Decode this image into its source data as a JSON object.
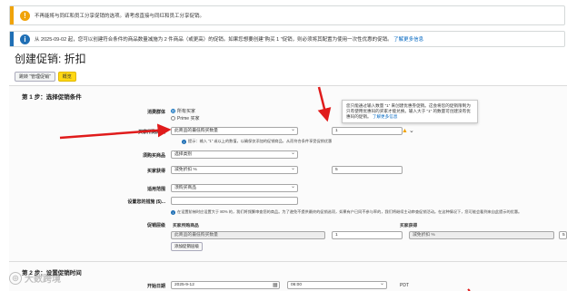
{
  "alerts": {
    "warning": {
      "text": "不再能将与同红和员工分享促销的选项。请考虑直接与同红和员工分享促销。"
    },
    "info": {
      "text": "从 2025-09-02 起，您可以创建符合条件的商品数量减施为 2 件商品（或更高）的促销。如果您想要创建“购买 1 ”促销，则必须将其配置为使用一次性优惠的促销。",
      "link": "了解更多信息"
    }
  },
  "page": {
    "title": "创建促销: 折扣",
    "badges": [
      "跳转 “管理促销”",
      "概览"
    ]
  },
  "step1": {
    "title": "第 1 步：选择促销条件",
    "buyer": {
      "label": "消费群体",
      "options": [
        "所有买家",
        "Prime 买家"
      ],
      "selected": 0
    },
    "condition": {
      "label": "买家所购商品",
      "select_value": "此商品的最低购买数量",
      "qty": "1",
      "hint": "提示：输入 “1” 或以上的数值，以确保仅添加的促销商品，从而符合条件享受促销优惠"
    },
    "purchased_items": {
      "label": "须购买商品",
      "select_value": "选择类别"
    },
    "buyer_gets": {
      "label": "买家获得",
      "select_value": "减免折扣 %",
      "value": "5"
    },
    "applies_to": {
      "label": "适用范围",
      "select_value": "须购买商品"
    },
    "tiers": {
      "label": "设置您的措施 ($)...",
      "hint": "在设置阶梯时应设置大于 80% 的，我们将频繁审查您的商品。为了避免不提供最终的促销选项，如果有户已同不参与率的，我们将继续主动审查促销活动。在这种情况下，您可能会看到来自此提示的优惠。"
    },
    "tiers_table": {
      "label": "促销层级",
      "headers": [
        "买家所购商品",
        "买家获得"
      ],
      "row": {
        "condition": "此商品的最低购买数量",
        "qty": "1",
        "benefit": "减免折扣 %",
        "value": "5"
      },
      "add_button": "添加促销层级"
    }
  },
  "tooltip": {
    "text": "您只能通过输入数量 “1” 来创建优惠券促销。这会将您的促销限制为只有使用优惠码的买家才能兑换。输入大于 “1” 的数量可创建没有优惠码的促销。",
    "link": "了解更多信息"
  },
  "step2": {
    "title": "第 2 步：设置促销时间",
    "start": {
      "label": "开始日期",
      "date": "2025-9-12",
      "time": "06:00",
      "tz": "PDT"
    }
  },
  "watermark": {
    "text": "大数跨境"
  },
  "colors": {
    "warning": "#f0a30a",
    "info": "#1f6fb5",
    "arrow": "#e01b1b",
    "accent": "#ffd814"
  }
}
